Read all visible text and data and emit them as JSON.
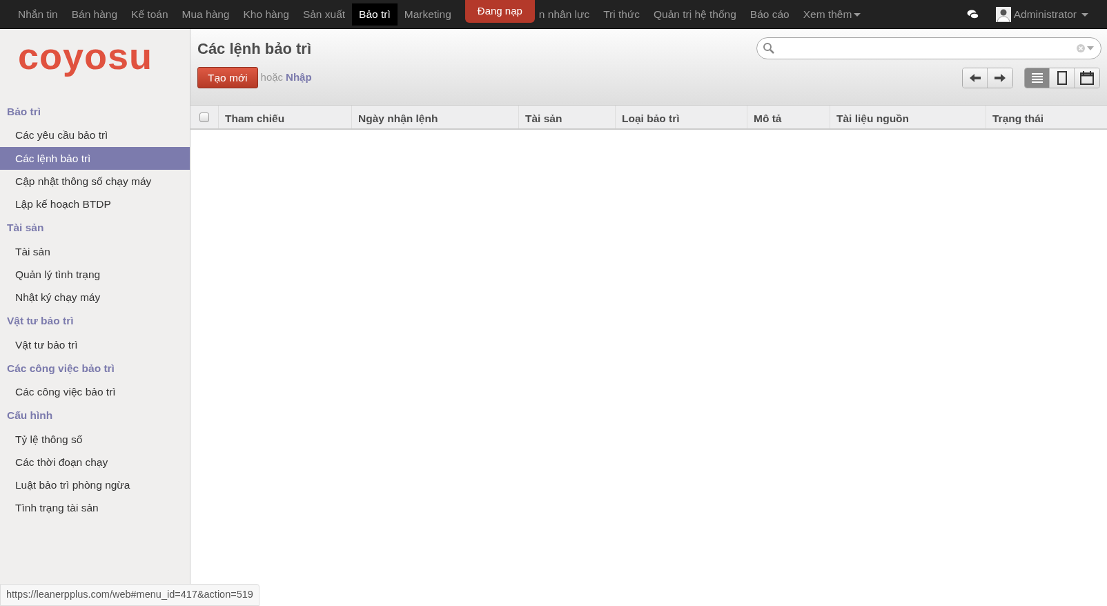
{
  "top_menu": [
    {
      "kind": "menu",
      "label": "Nhắn tin",
      "selected": false
    },
    {
      "kind": "menu",
      "label": "Bán hàng",
      "selected": false
    },
    {
      "kind": "menu",
      "label": "Kế toán",
      "selected": false
    },
    {
      "kind": "menu",
      "label": "Mua hàng",
      "selected": false
    },
    {
      "kind": "menu",
      "label": "Kho hàng",
      "selected": false
    },
    {
      "kind": "menu",
      "label": "Sản xuất",
      "selected": false
    },
    {
      "kind": "menu",
      "label": "Bảo trì",
      "selected": true
    },
    {
      "kind": "menu",
      "label": "Marketing",
      "selected": false
    },
    {
      "kind": "loading",
      "label": "Đang nạp"
    },
    {
      "kind": "menu",
      "label": "n nhân lực",
      "selected": false
    },
    {
      "kind": "menu",
      "label": "Tri thức",
      "selected": false
    },
    {
      "kind": "menu",
      "label": "Quản trị hệ thống",
      "selected": false
    },
    {
      "kind": "menu",
      "label": "Báo cáo",
      "selected": false
    },
    {
      "kind": "dropdown",
      "label": "Xem thêm",
      "selected": false
    }
  ],
  "user": {
    "name": "Administrator"
  },
  "logo": {
    "text": "coyosu"
  },
  "sidebar": {
    "sections": [
      {
        "title": "Bảo trì",
        "items": [
          {
            "label": "Các yêu cầu bảo trì",
            "selected": false
          },
          {
            "label": "Các lệnh bảo trì",
            "selected": true
          },
          {
            "label": "Cập nhật thông số chạy máy",
            "selected": false
          },
          {
            "label": "Lập kế hoạch BTDP",
            "selected": false
          }
        ]
      },
      {
        "title": "Tài sản",
        "items": [
          {
            "label": "Tài sản",
            "selected": false
          },
          {
            "label": "Quản lý tình trạng",
            "selected": false
          },
          {
            "label": "Nhật ký chạy máy",
            "selected": false
          }
        ]
      },
      {
        "title": "Vật tư bảo trì",
        "items": [
          {
            "label": "Vật tư bảo trì",
            "selected": false
          }
        ]
      },
      {
        "title": "Các công việc bảo trì",
        "items": [
          {
            "label": "Các công việc bảo trì",
            "selected": false
          }
        ]
      },
      {
        "title": "Cấu hình",
        "items": [
          {
            "label": "Tỷ lệ thông số",
            "selected": false
          },
          {
            "label": "Các thời đoạn chạy",
            "selected": false
          },
          {
            "label": "Luật bảo trì phòng ngừa",
            "selected": false
          },
          {
            "label": "Tình trạng tài sản",
            "selected": false
          }
        ]
      }
    ]
  },
  "page": {
    "title": "Các lệnh bảo trì",
    "create_button": "Tạo mới",
    "or_text": "hoặc",
    "import_link": "Nhập"
  },
  "view_switcher": [
    {
      "kind": "list",
      "selected": true
    },
    {
      "kind": "form",
      "selected": false
    },
    {
      "kind": "calendar",
      "selected": false
    }
  ],
  "table": {
    "select_all_checked": false,
    "columns": [
      "Tham chiếu",
      "Ngày nhận lệnh",
      "Tài sản",
      "Loại bảo trì",
      "Mô tả",
      "Tài liệu nguồn",
      "Trạng thái"
    ]
  },
  "status_bar": {
    "url": "https://leanerpplus.com/web#menu_id=417&action=519"
  }
}
